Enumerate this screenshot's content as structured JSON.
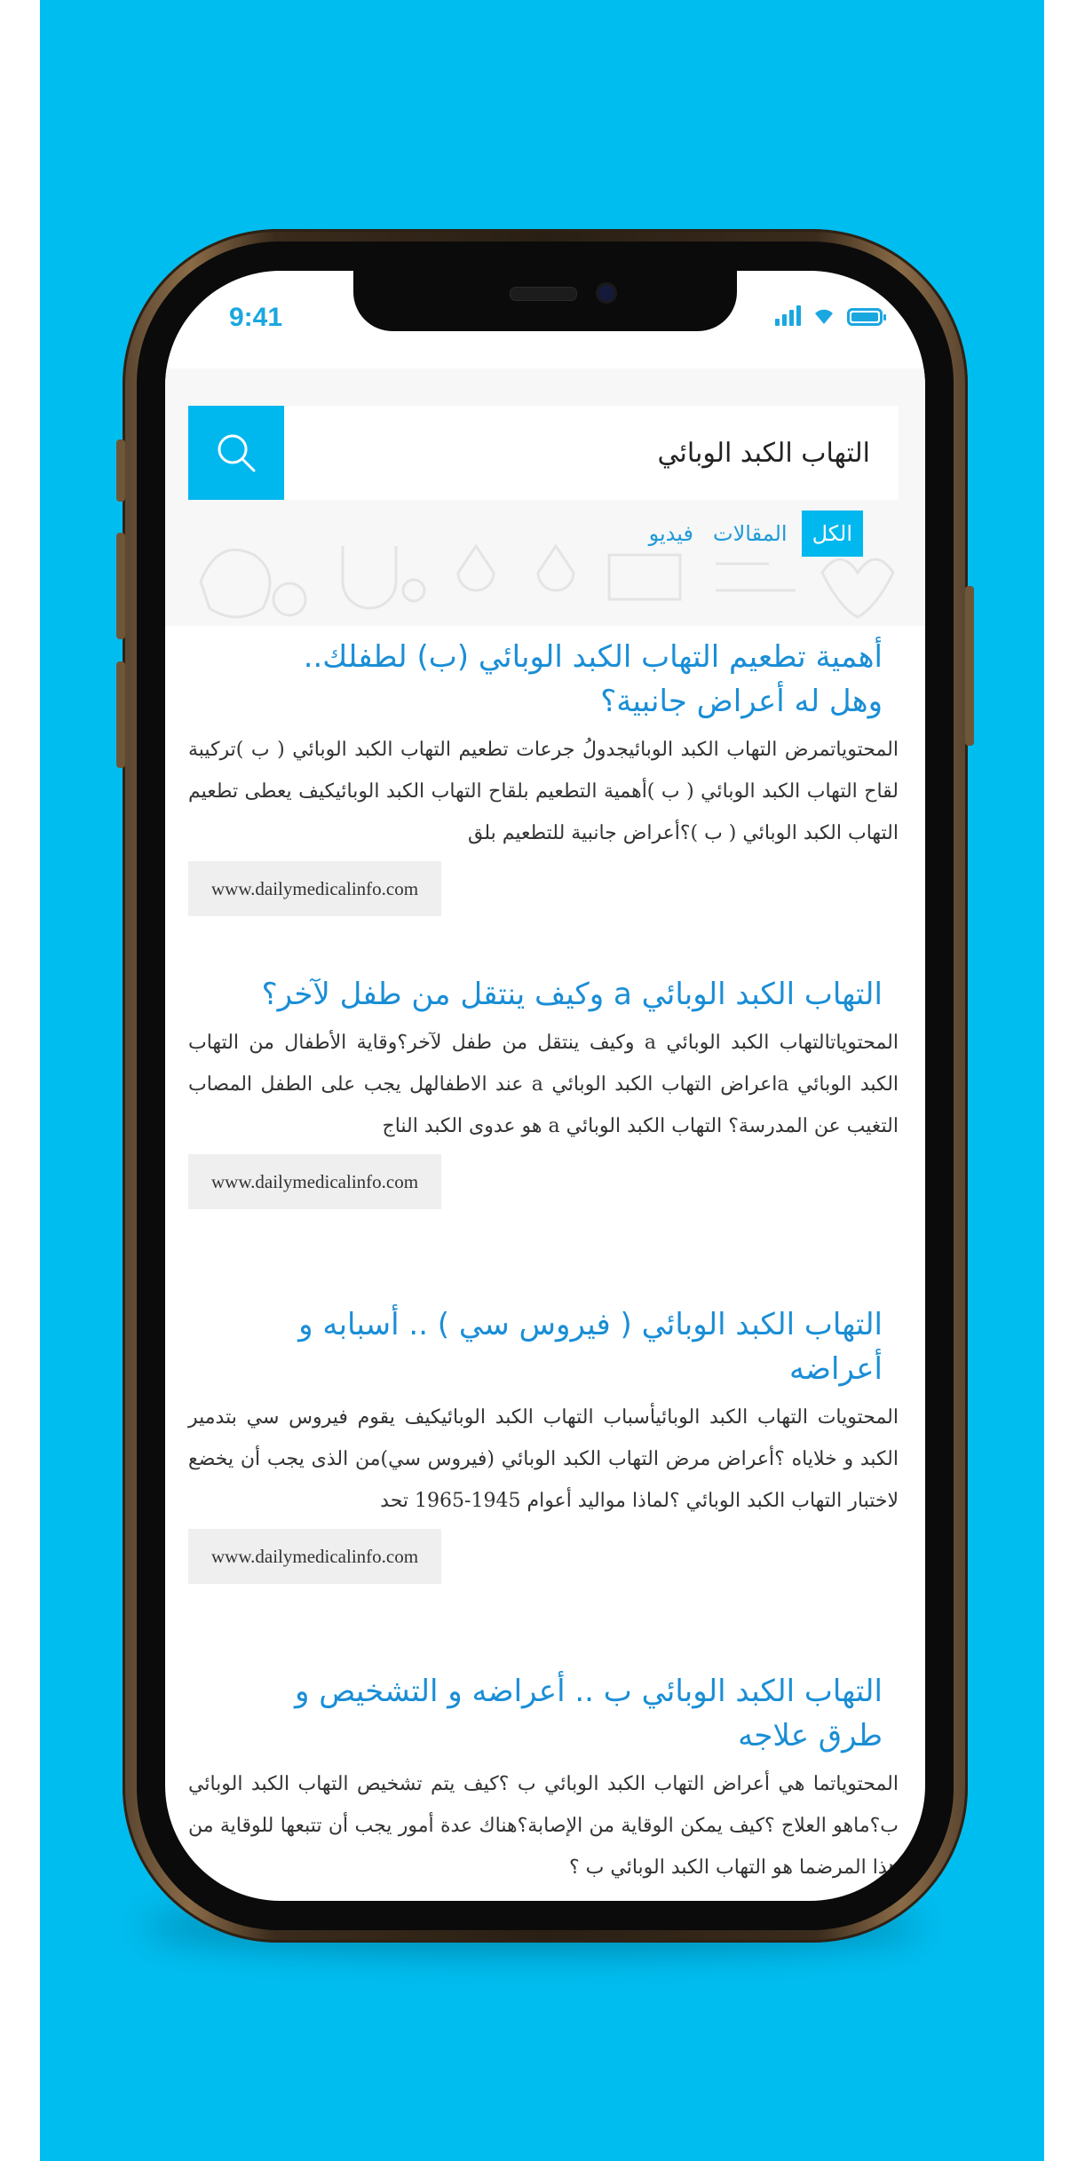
{
  "status_bar": {
    "time": "9:41"
  },
  "search": {
    "query": "التهاب الكبد الوبائي",
    "icon": "search-icon"
  },
  "tabs": [
    {
      "label": "الكل",
      "active": true
    },
    {
      "label": "المقالات",
      "active": false
    },
    {
      "label": "فيديو",
      "active": false
    }
  ],
  "results": [
    {
      "title_line1": "أهمية تطعيم التهاب الكبد الوبائي (ب) لطفلك..",
      "title_line2": "وهل له أعراض جانبية؟",
      "snippet": "المحتوياتمرض التهاب الكبد الوبائيجدولُ جرعات تطعيم التهاب الكبد الوبائي ( ب )تركيبة لقاح التهاب الكبد الوبائي ( ب )أهمية التطعيم بلقاح التهاب الكبد الوبائيكيف يعطى تطعيم التهاب الكبد الوبائي ( ب )؟أعراض جانبية للتطعيم بلق",
      "url": "www.dailymedicalinfo.com"
    },
    {
      "title_line1": "التهاب الكبد الوبائي a وكيف ينتقل من طفل لآخر؟",
      "title_line2": "",
      "snippet": "المحتوياتالتهاب الكبد الوبائي a وكيف ينتقل من طفل لآخر؟وقاية الأطفال من التهاب الكبد الوبائي aاعراض التهاب الكبد الوبائي a عند الاطفالهل يجب على الطفل المصاب التغيب عن المدرسة؟ التهاب الكبد الوبائي a هو عدوى الكبد الناج",
      "url": "www.dailymedicalinfo.com"
    },
    {
      "title_line1": "التهاب الكبد الوبائي ( فيروس سي ) .. أسبابه و",
      "title_line2": "أعراضه",
      "snippet": "المحتويات التهاب الكبد الوبائيأسباب التهاب الكبد الوبائيكيف يقوم فيروس سي بتدمير الكبد و خلاياه ؟أعراض مرض التهاب الكبد الوبائي (فيروس سي)من الذى يجب أن يخضع لاختبار التهاب الكبد الوبائي ؟لماذا مواليد أعوام 1945-1965 تحد",
      "url": "www.dailymedicalinfo.com"
    },
    {
      "title_line1": "التهاب الكبد الوبائي ب .. أعراضه و التشخيص و",
      "title_line2": "طرق علاجه",
      "snippet": "المحتوياتما هي أعراض التهاب الكبد الوبائي ب ؟كيف يتم تشخيص التهاب الكبد الوبائي ب؟ماهو العلاج ؟كيف يمكن الوقاية من الإصابة؟هناك عدة أمور يجب أن تتبعها للوقاية من هذا المرضما هو التهاب الكبد الوبائي ب ؟",
      "url": ""
    }
  ],
  "colors": {
    "background": "#00bdf0",
    "accent": "#00b7ee",
    "title": "#1a8ed6"
  }
}
